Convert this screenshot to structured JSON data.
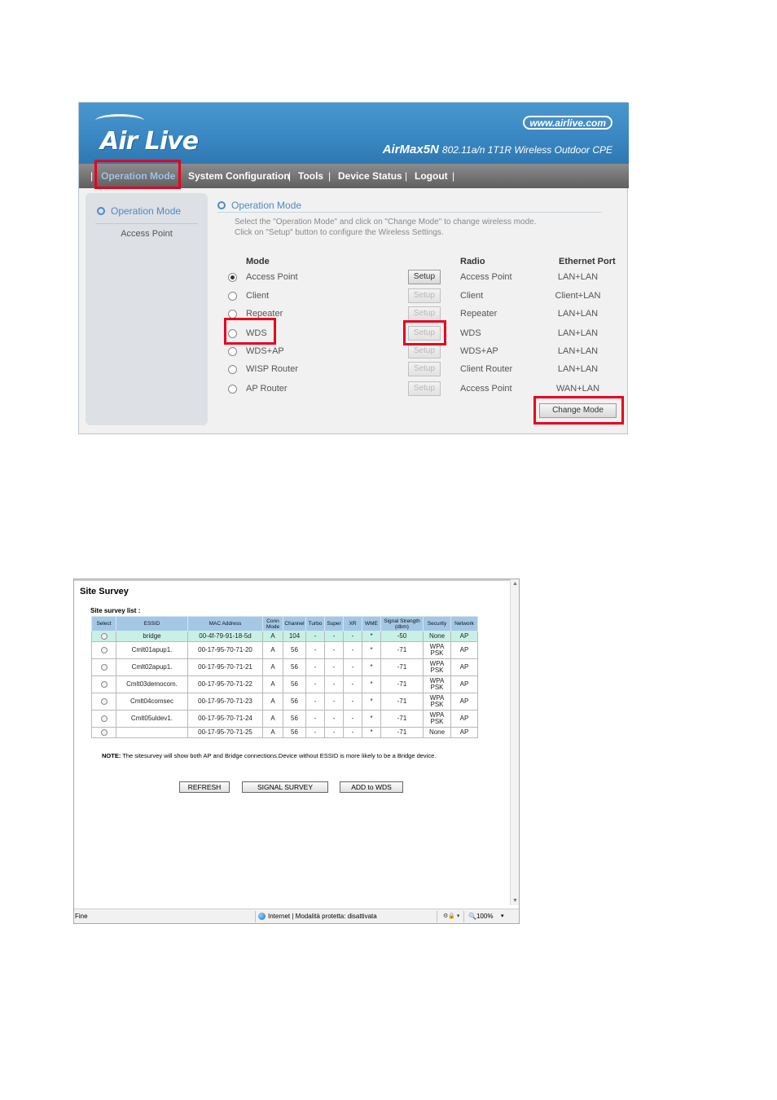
{
  "airlive": {
    "logo": "Air Live",
    "website": "www.airlive.com",
    "product_model": "AirMax5N",
    "product_desc": "802.11a/n 1T1R Wireless Outdoor CPE",
    "nav": [
      "Operation Mode",
      "System Configuration",
      "Tools",
      "Device Status",
      "Logout"
    ],
    "nav_sep": "|",
    "sidebar": {
      "title": "Operation Mode",
      "items": [
        "Access Point"
      ]
    },
    "main": {
      "title": "Operation Mode",
      "instructions": [
        "Select the \"Operation Mode\" and click on \"Change Mode\" to change wireless mode.",
        "Click on \"Setup\" button to configure the Wireless Settings."
      ],
      "headers": {
        "mode": "Mode",
        "radio": "Radio",
        "ethernet": "Ethernet Port"
      },
      "rows": [
        {
          "mode": "Access Point",
          "radio": "Access Point",
          "ethernet": "LAN+LAN",
          "checked": true,
          "setup_enabled": true
        },
        {
          "mode": "Client",
          "radio": "Client",
          "ethernet": "Client+LAN",
          "checked": false,
          "setup_enabled": false
        },
        {
          "mode": "Repeater",
          "radio": "Repeater",
          "ethernet": "LAN+LAN",
          "checked": false,
          "setup_enabled": false
        },
        {
          "mode": "WDS",
          "radio": "WDS",
          "ethernet": "LAN+LAN",
          "checked": false,
          "setup_enabled": false
        },
        {
          "mode": "WDS+AP",
          "radio": "WDS+AP",
          "ethernet": "LAN+LAN",
          "checked": false,
          "setup_enabled": false
        },
        {
          "mode": "WISP Router",
          "radio": "Client Router",
          "ethernet": "LAN+LAN",
          "checked": false,
          "setup_enabled": false
        },
        {
          "mode": "AP Router",
          "radio": "Access Point",
          "ethernet": "WAN+LAN",
          "checked": false,
          "setup_enabled": false
        }
      ],
      "setup_label": "Setup",
      "change_mode_label": "Change Mode"
    },
    "highlight_color": "#e8001c",
    "banner_color": "#3a88c3"
  },
  "site_survey": {
    "title": "Site Survey",
    "list_label": "Site survey list :",
    "columns": [
      "Select",
      "ESSID",
      "MAC Address",
      "Conn Mode",
      "Channel",
      "Turbo",
      "Super",
      "XR",
      "WME",
      "Signal Strength (dbm)",
      "Security",
      "Network"
    ],
    "rows": [
      {
        "essid": "bridge",
        "mac": "00-4f-79-91-18-5d",
        "conn": "A",
        "channel": "104",
        "turbo": "-",
        "super": "-",
        "xr": "-",
        "wme": "*",
        "signal": "-50",
        "security": "None",
        "network": "AP"
      },
      {
        "essid": "Cmlt01apup1.",
        "mac": "00-17-95-70-71-20",
        "conn": "A",
        "channel": "56",
        "turbo": "-",
        "super": "-",
        "xr": "-",
        "wme": "*",
        "signal": "-71",
        "security": "WPA PSK",
        "network": "AP"
      },
      {
        "essid": "Cmlt02apup1.",
        "mac": "00-17-95-70-71-21",
        "conn": "A",
        "channel": "56",
        "turbo": "-",
        "super": "-",
        "xr": "-",
        "wme": "*",
        "signal": "-71",
        "security": "WPA PSK",
        "network": "AP"
      },
      {
        "essid": "Cmlt03democom.",
        "mac": "00-17-95-70-71-22",
        "conn": "A",
        "channel": "56",
        "turbo": "-",
        "super": "-",
        "xr": "-",
        "wme": "*",
        "signal": "-71",
        "security": "WPA PSK",
        "network": "AP"
      },
      {
        "essid": "Cmlt04comsec",
        "mac": "00-17-95-70-71-23",
        "conn": "A",
        "channel": "56",
        "turbo": "-",
        "super": "-",
        "xr": "-",
        "wme": "*",
        "signal": "-71",
        "security": "WPA PSK",
        "network": "AP"
      },
      {
        "essid": "Cmlt05uldev1.",
        "mac": "00-17-95-70-71-24",
        "conn": "A",
        "channel": "56",
        "turbo": "-",
        "super": "-",
        "xr": "-",
        "wme": "*",
        "signal": "-71",
        "security": "WPA PSK",
        "network": "AP"
      },
      {
        "essid": "",
        "mac": "00-17-95-70-71-25",
        "conn": "A",
        "channel": "56",
        "turbo": "-",
        "super": "-",
        "xr": "-",
        "wme": "*",
        "signal": "-71",
        "security": "None",
        "network": "AP"
      }
    ],
    "note_label": "NOTE:",
    "note_text": "The sitesurvey will show both AP and Bridge connections.Device without ESSID is more likely to be a Bridge device.",
    "buttons": {
      "refresh": "REFRESH",
      "signal": "SIGNAL SURVEY",
      "add_wds": "ADD to WDS"
    },
    "statusbar": {
      "status": "Fine",
      "zone": "Internet | Modalità protetta: disattivata",
      "zoom": "100%"
    },
    "header_color": "#a3c8e6",
    "selected_row_color": "#c9f0e6"
  }
}
